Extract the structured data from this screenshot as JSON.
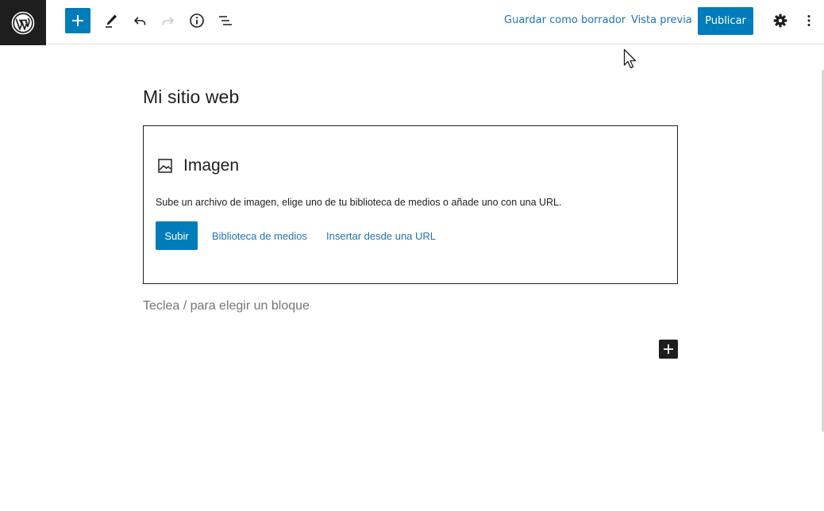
{
  "toolbar": {
    "save_draft_label": "Guardar como borrador",
    "preview_label": "Vista previa",
    "publish_label": "Publicar"
  },
  "editor": {
    "site_title": "Mi sitio web",
    "image_block": {
      "title": "Imagen",
      "instructions": "Sube un archivo de imagen, elige uno de tu biblioteca de medios o añade uno con una URL.",
      "upload_label": "Subir",
      "media_library_label": "Biblioteca de medios",
      "insert_url_label": "Insertar desde una URL"
    },
    "block_placeholder": "Teclea / para elegir un bloque"
  },
  "icons": {
    "logo": "wordpress-logo-icon",
    "add": "plus-icon",
    "tools": "pencil-icon",
    "undo": "undo-icon",
    "redo": "redo-icon",
    "details": "info-icon",
    "outline": "list-view-icon",
    "settings": "gear-icon",
    "options": "more-vertical-icon",
    "image": "image-icon",
    "inline_add": "plus-icon"
  },
  "colors": {
    "primary": "#007cba",
    "link": "#2271b1",
    "dark": "#1e1e1e",
    "placeholder": "#757575"
  }
}
